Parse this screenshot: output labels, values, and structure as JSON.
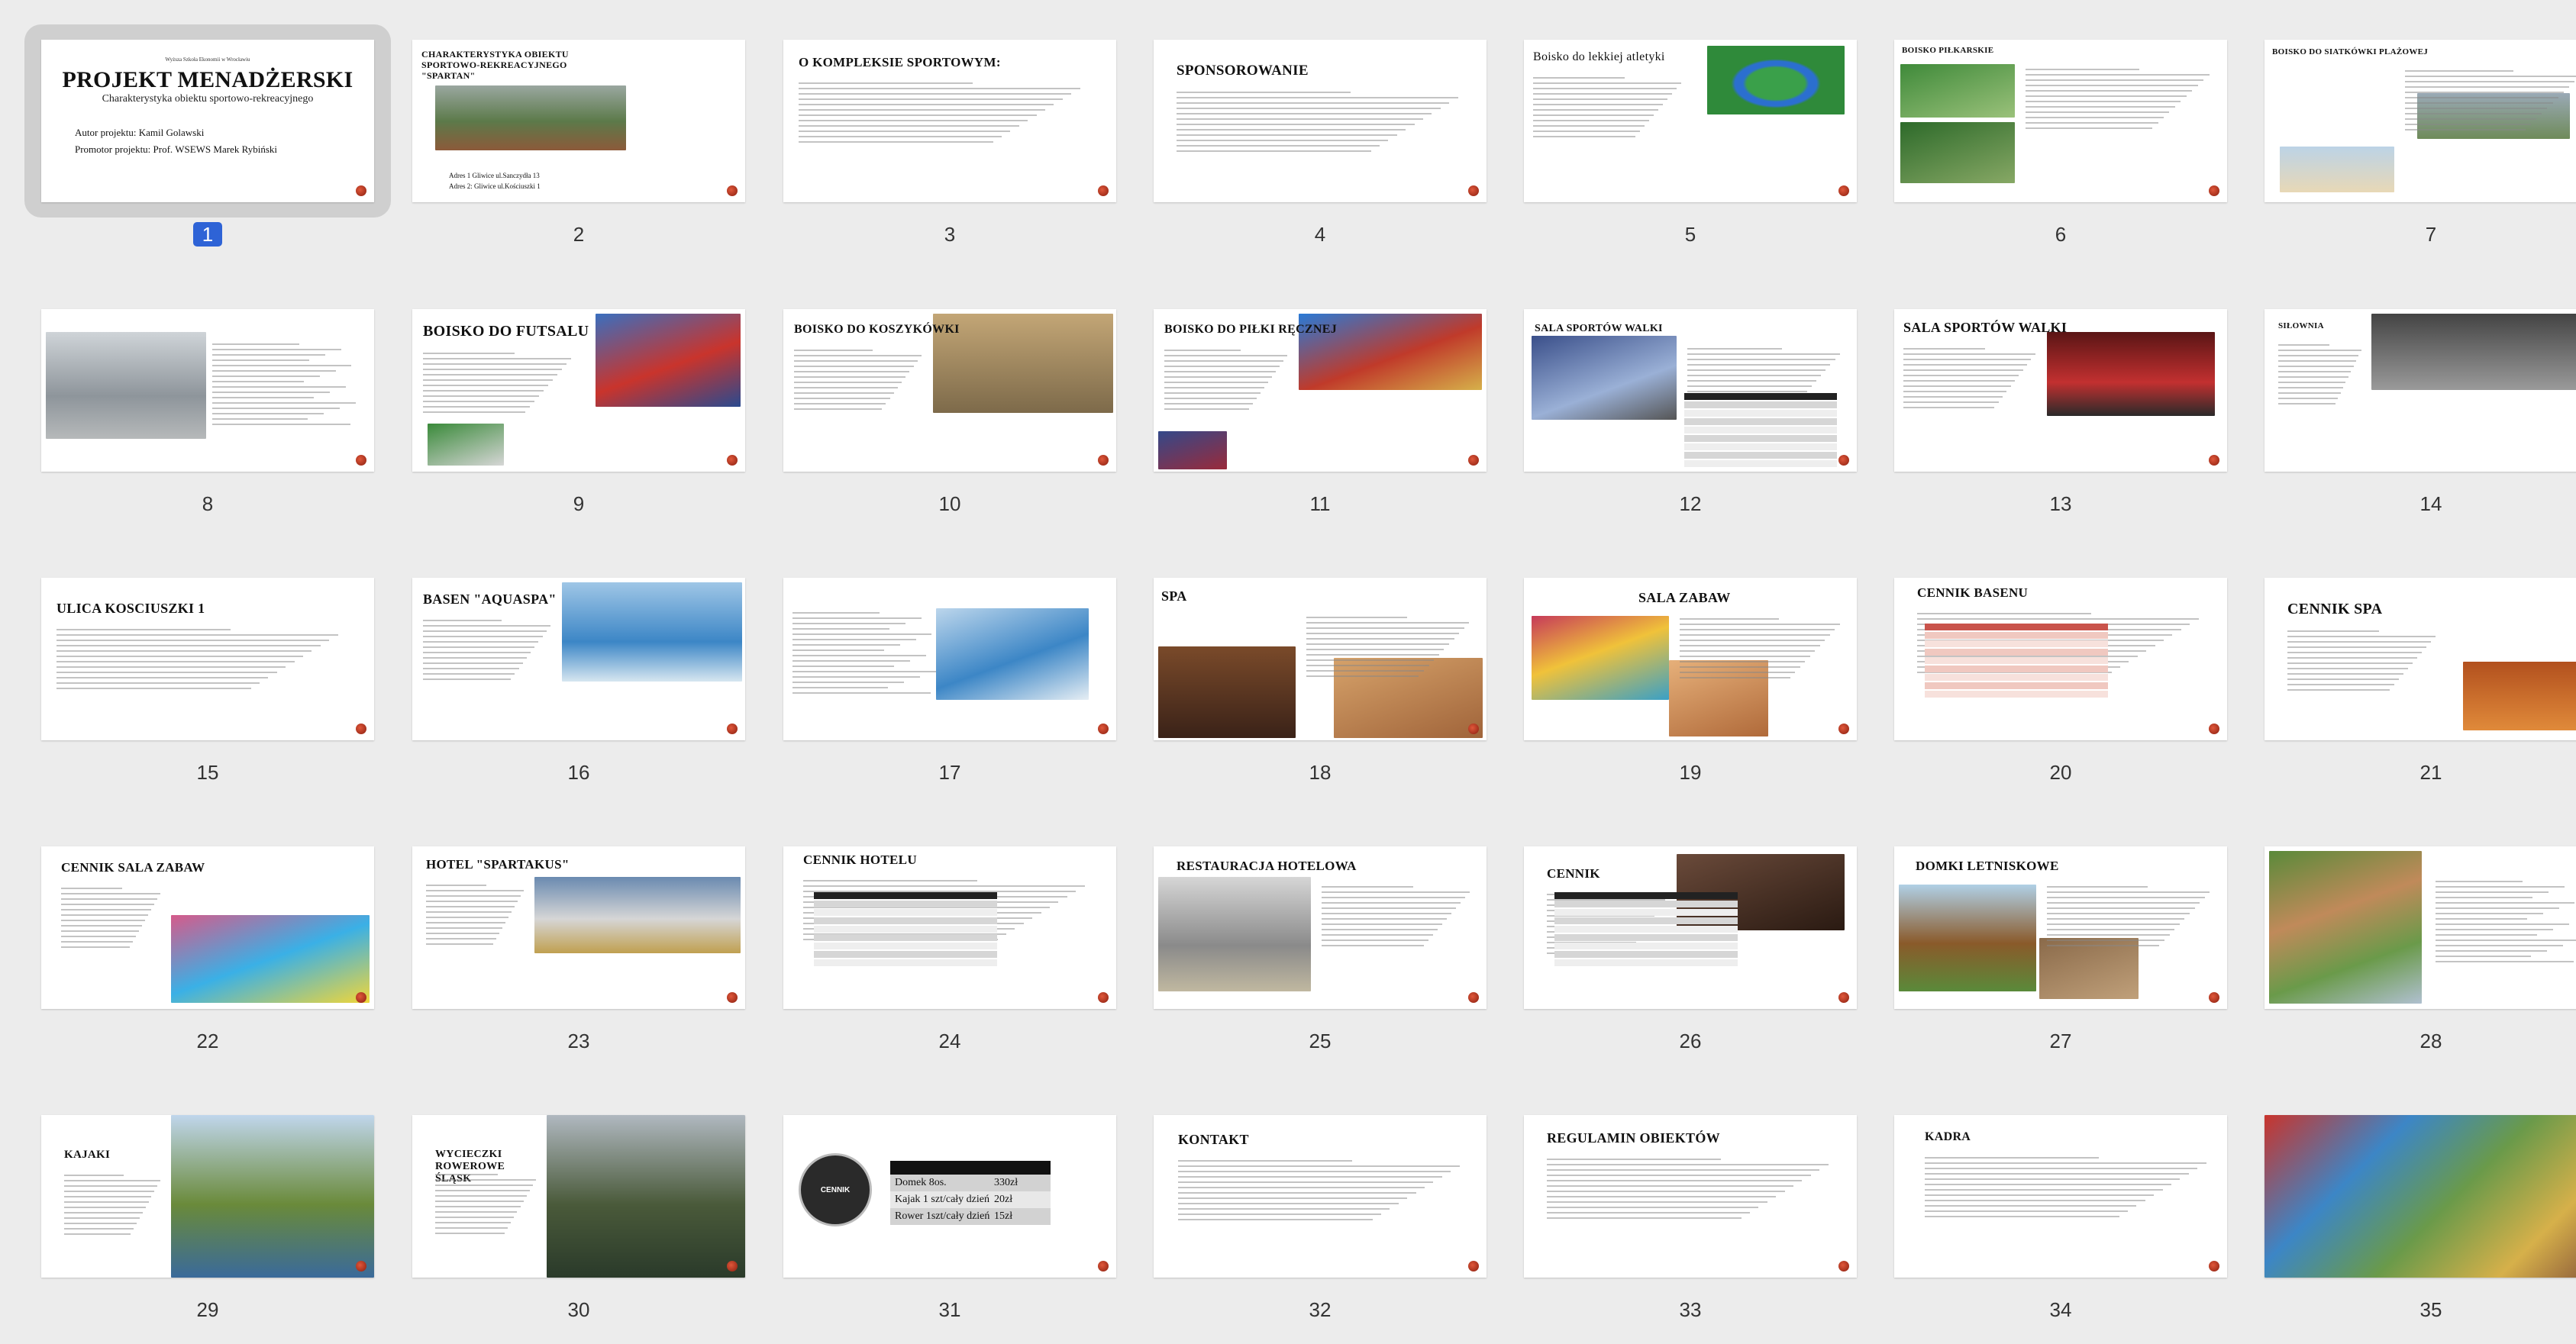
{
  "slides": [
    {
      "n": "1",
      "title": "PROJEKT MENADŻERSKI",
      "subtitle": "Charakterystyka obiektu sportowo-rekreacyjnego",
      "small": "Wyższa Szkoła Ekonomii w Wrocławiu",
      "lines": [
        "Autor projektu: Kamil Golawski",
        "Promotor projektu: Prof. WSEWS Marek Rybiński"
      ]
    },
    {
      "n": "2",
      "title": "CHARAKTERYSTYKA OBIEKTU SPORTOWO-REKREACYJNEGO \"SPARTAN\"",
      "lines": [
        "Adres 1 Gliwice ul.Sanczydła 13",
        "Adres 2: Gliwice ul.Kościuszki 1"
      ]
    },
    {
      "n": "3",
      "title": "O KOMPLEKSIE SPORTOWYM:"
    },
    {
      "n": "4",
      "title": "SPONSOROWANIE"
    },
    {
      "n": "5",
      "title": "Boisko do lekkiej atletyki"
    },
    {
      "n": "6",
      "title": "BOISKO PIŁKARSKIE"
    },
    {
      "n": "7",
      "title": "BOISKO DO SIATKÓWKI PLAŻOWEJ"
    },
    {
      "n": "8",
      "title": ""
    },
    {
      "n": "9",
      "title": "BOISKO DO FUTSALU"
    },
    {
      "n": "10",
      "title": "BOISKO DO KOSZYKÓWKI"
    },
    {
      "n": "11",
      "title": "BOISKO DO PIŁKI RĘCZNEJ"
    },
    {
      "n": "12",
      "title": "SALA SPORTÓW WALKI"
    },
    {
      "n": "13",
      "title": "SALA SPORTÓW WALKI"
    },
    {
      "n": "14",
      "title": "SIŁOWNIA"
    },
    {
      "n": "15",
      "title": "ULICA KOSCIUSZKI 1"
    },
    {
      "n": "16",
      "title": "BASEN \"AQUASPA\""
    },
    {
      "n": "17",
      "title": ""
    },
    {
      "n": "18",
      "title": "SPA"
    },
    {
      "n": "19",
      "title": "SALA ZABAW"
    },
    {
      "n": "20",
      "title": "CENNIK BASENU"
    },
    {
      "n": "21",
      "title": "CENNIK SPA"
    },
    {
      "n": "22",
      "title": "CENNIK SALA ZABAW"
    },
    {
      "n": "23",
      "title": "HOTEL \"SPARTAKUS\""
    },
    {
      "n": "24",
      "title": "CENNIK HOTELU"
    },
    {
      "n": "25",
      "title": "RESTAURACJA HOTELOWA"
    },
    {
      "n": "26",
      "title": "CENNIK"
    },
    {
      "n": "27",
      "title": "DOMKI LETNISKOWE"
    },
    {
      "n": "28",
      "title": ""
    },
    {
      "n": "29",
      "title": "KAJAKI"
    },
    {
      "n": "30",
      "title": "WYCIECZKI ROWEROWE ŚLĄSK"
    },
    {
      "n": "31",
      "title": "CENNIK",
      "table": [
        [
          "Domek 8os.",
          "330zł"
        ],
        [
          "Kajak 1 szt/cały dzień",
          "20zł"
        ],
        [
          "Rower 1szt/cały dzień",
          "15zł"
        ]
      ]
    },
    {
      "n": "32",
      "title": "KONTAKT"
    },
    {
      "n": "33",
      "title": "REGULAMIN OBIEKTÓW"
    },
    {
      "n": "34",
      "title": "KADRA"
    },
    {
      "n": "35",
      "title": ""
    }
  ],
  "selected": "1",
  "colors": {
    "selection": "#2e63d6",
    "dot": "#c2381f",
    "bg": "#ececec"
  }
}
